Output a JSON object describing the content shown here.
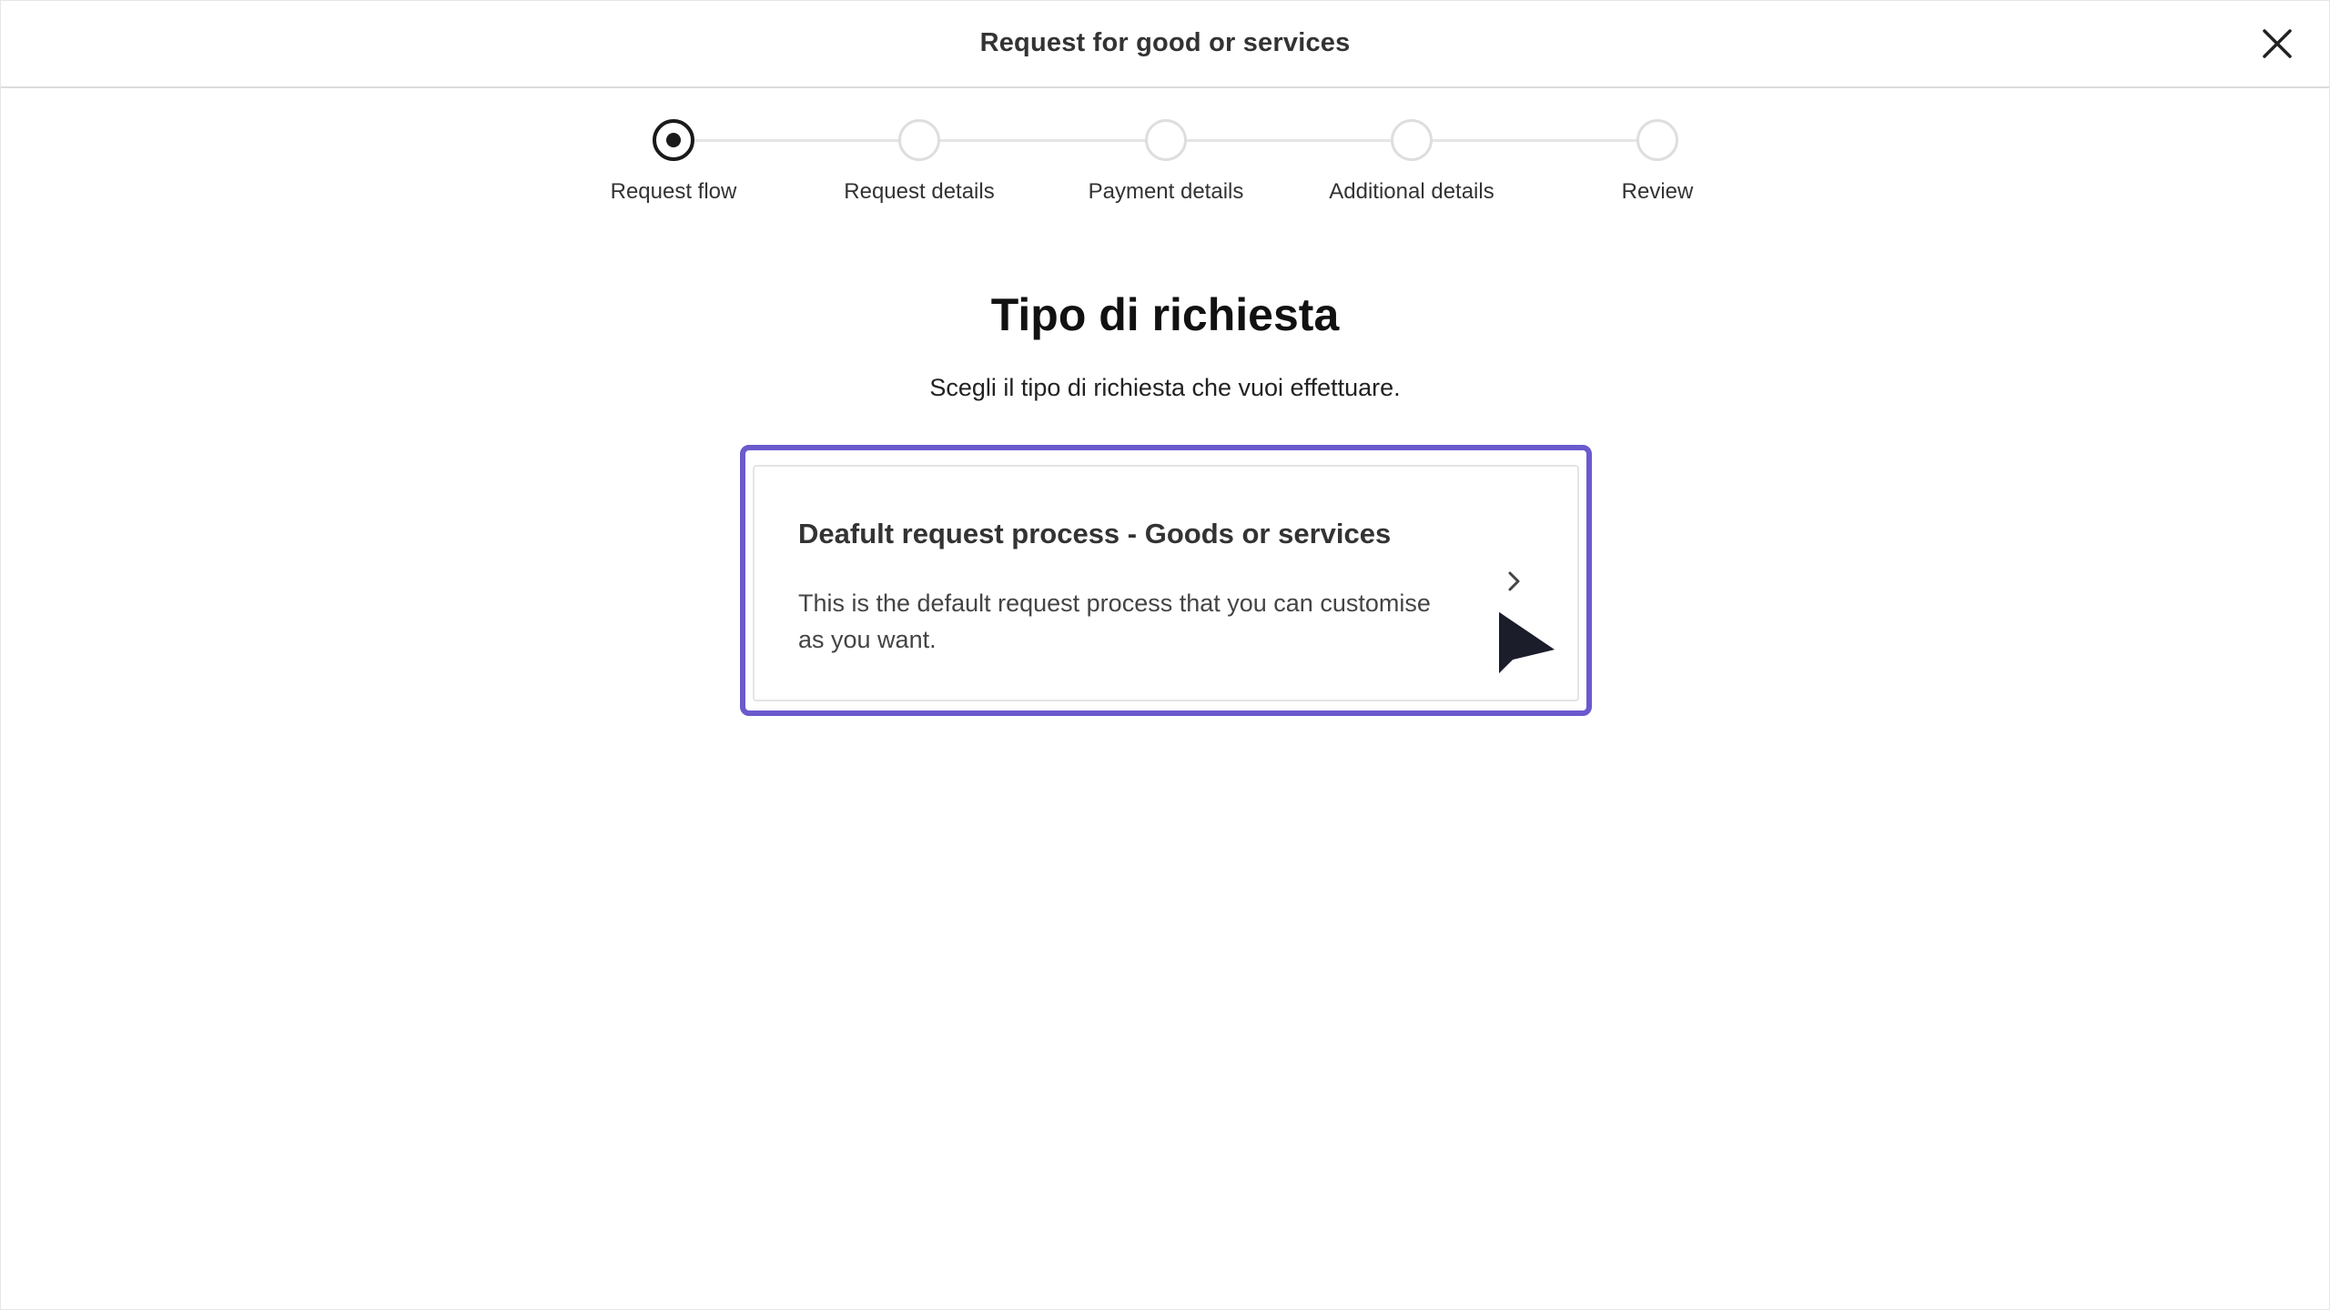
{
  "dialog": {
    "title": "Request for good or services",
    "close_icon": "close-icon"
  },
  "stepper": {
    "steps": [
      {
        "label": "Request flow",
        "state": "active"
      },
      {
        "label": "Request details",
        "state": "pending"
      },
      {
        "label": "Payment details",
        "state": "pending"
      },
      {
        "label": "Additional details",
        "state": "pending"
      },
      {
        "label": "Review",
        "state": "pending"
      }
    ]
  },
  "main": {
    "title": "Tipo di richiesta",
    "subtitle": "Scegli il tipo di richiesta che vuoi effettuare."
  },
  "option": {
    "title": "Deafult request process - Goods or services",
    "description": "This is the default request process that you can customise as you want.",
    "icon": "chevron-right-icon",
    "highlight_color": "#6a5acd"
  }
}
